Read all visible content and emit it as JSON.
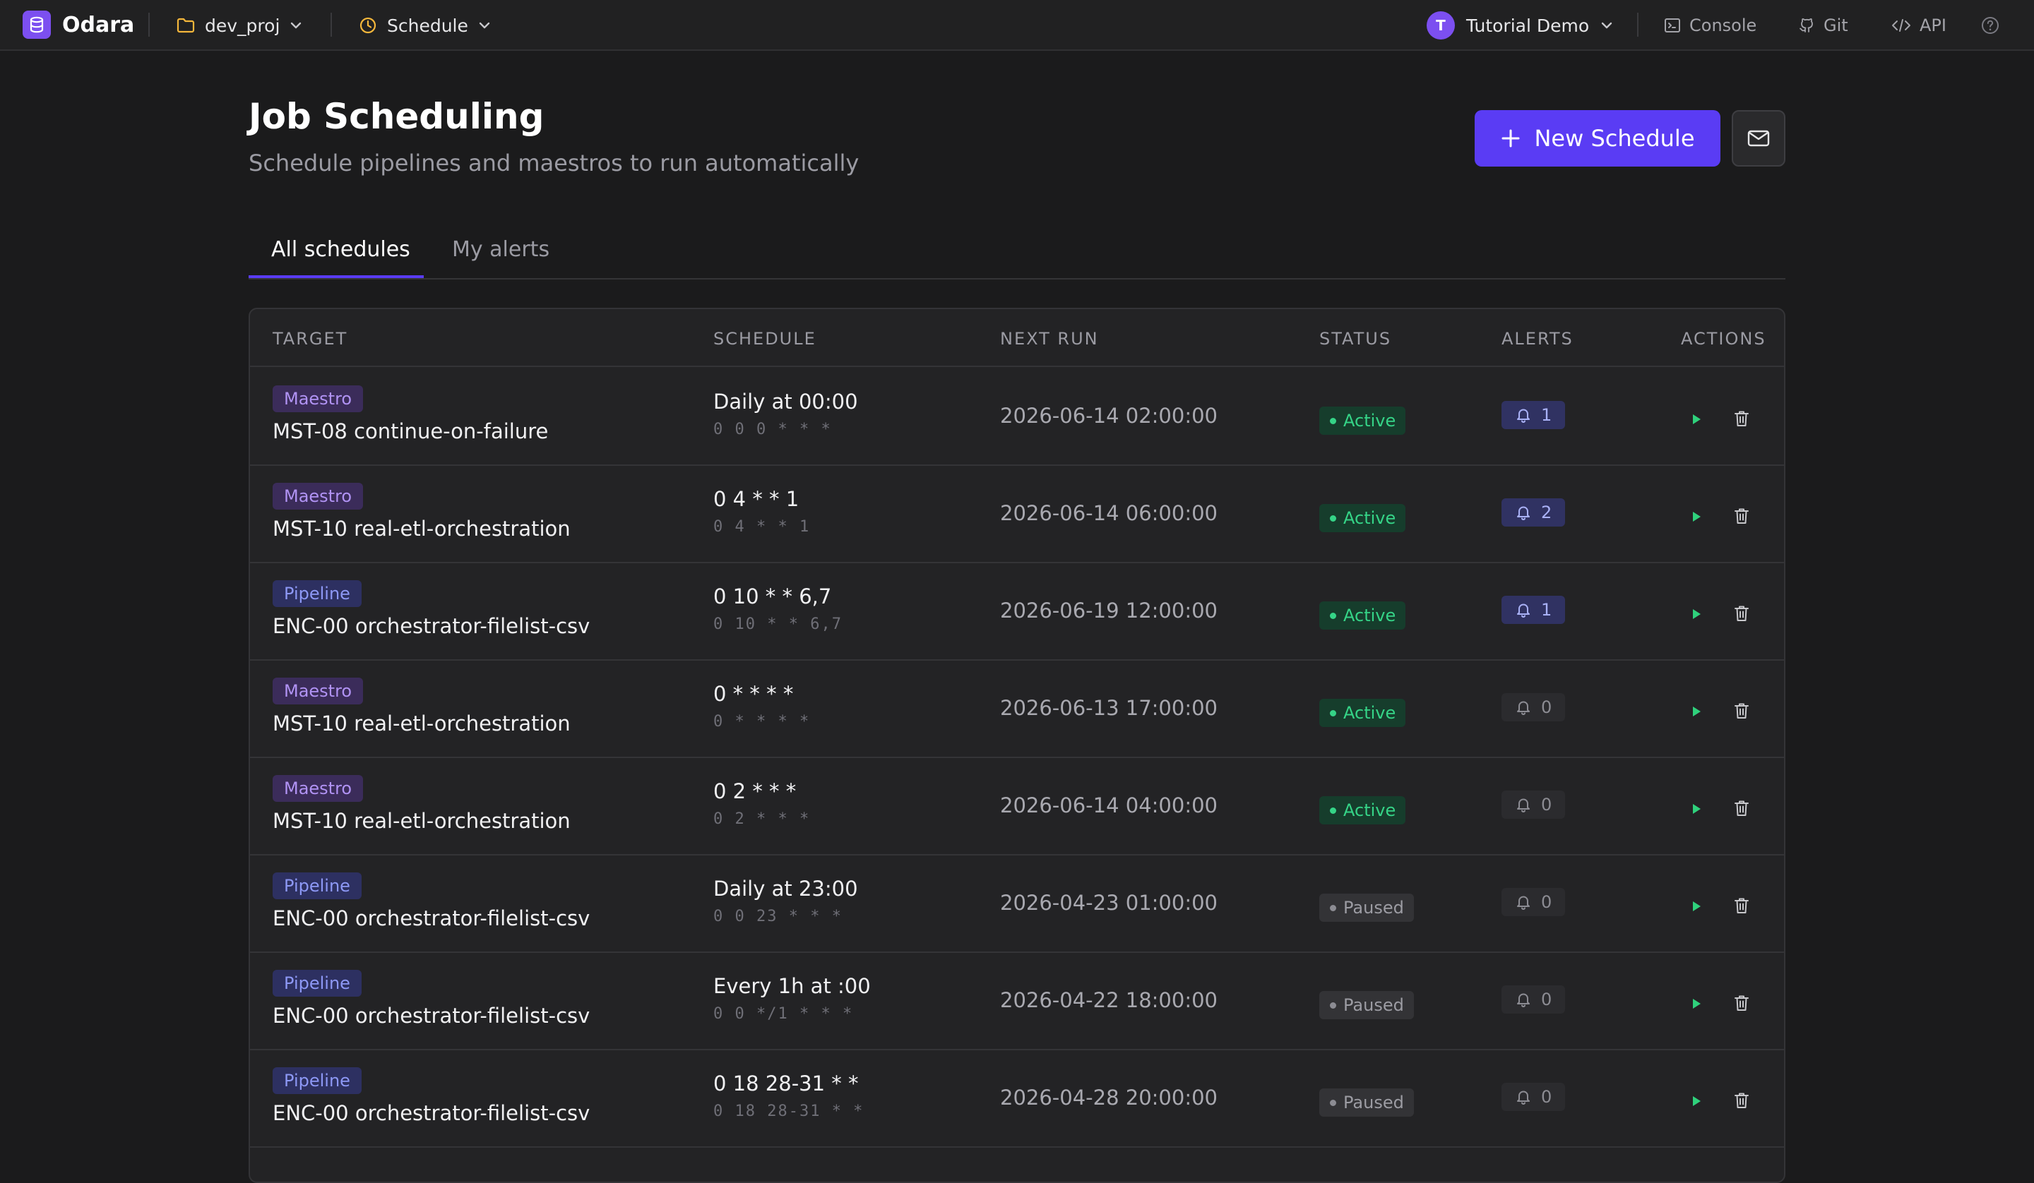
{
  "app": {
    "name": "Odara"
  },
  "topbar": {
    "project": "dev_proj",
    "section": "Schedule",
    "user": {
      "name": "Tutorial Demo",
      "initial": "T"
    },
    "links": {
      "console": "Console",
      "git": "Git",
      "api": "API"
    }
  },
  "header": {
    "title": "Job Scheduling",
    "subtitle": "Schedule pipelines and maestros to run automatically",
    "new_button": "New Schedule"
  },
  "tabs": [
    {
      "label": "All schedules",
      "active": true
    },
    {
      "label": "My alerts",
      "active": false
    }
  ],
  "table": {
    "columns": {
      "target": "TARGET",
      "schedule": "SCHEDULE",
      "next_run": "NEXT RUN",
      "status": "STATUS",
      "alerts": "ALERTS",
      "actions": "ACTIONS"
    },
    "rows": [
      {
        "type": "Maestro",
        "target": "MST-08 continue-on-failure",
        "schedule": "Daily at 00:00",
        "cron": "0 0 0 * * *",
        "next_run": "2026-06-14 02:00:00",
        "status": "Active",
        "alerts": "1"
      },
      {
        "type": "Maestro",
        "target": "MST-10 real-etl-orchestration",
        "schedule": "0 4 * * 1",
        "cron": "0 4 * * 1",
        "next_run": "2026-06-14 06:00:00",
        "status": "Active",
        "alerts": "2"
      },
      {
        "type": "Pipeline",
        "target": "ENC-00 orchestrator-filelist-csv",
        "schedule": "0 10 * * 6,7",
        "cron": "0 10 * * 6,7",
        "next_run": "2026-06-19 12:00:00",
        "status": "Active",
        "alerts": "1"
      },
      {
        "type": "Maestro",
        "target": "MST-10 real-etl-orchestration",
        "schedule": "0 * * * *",
        "cron": "0 * * * *",
        "next_run": "2026-06-13 17:00:00",
        "status": "Active",
        "alerts": "0"
      },
      {
        "type": "Maestro",
        "target": "MST-10 real-etl-orchestration",
        "schedule": "0 2 * * *",
        "cron": "0 2 * * *",
        "next_run": "2026-06-14 04:00:00",
        "status": "Active",
        "alerts": "0"
      },
      {
        "type": "Pipeline",
        "target": "ENC-00 orchestrator-filelist-csv",
        "schedule": "Daily at 23:00",
        "cron": "0 0 23 * * *",
        "next_run": "2026-04-23 01:00:00",
        "status": "Paused",
        "alerts": "0"
      },
      {
        "type": "Pipeline",
        "target": "ENC-00 orchestrator-filelist-csv",
        "schedule": "Every 1h at :00",
        "cron": "0 0 */1 * * *",
        "next_run": "2026-04-22 18:00:00",
        "status": "Paused",
        "alerts": "0"
      },
      {
        "type": "Pipeline",
        "target": "ENC-00 orchestrator-filelist-csv",
        "schedule": "0 18 28-31 * *",
        "cron": "0 18 28-31 * *",
        "next_run": "2026-04-28 20:00:00",
        "status": "Paused",
        "alerts": "0"
      }
    ]
  },
  "colors": {
    "accent": "#5a3cf4",
    "brand": "#7c4ff0",
    "active": "#35d487",
    "run_icon": "#2fd17c"
  }
}
